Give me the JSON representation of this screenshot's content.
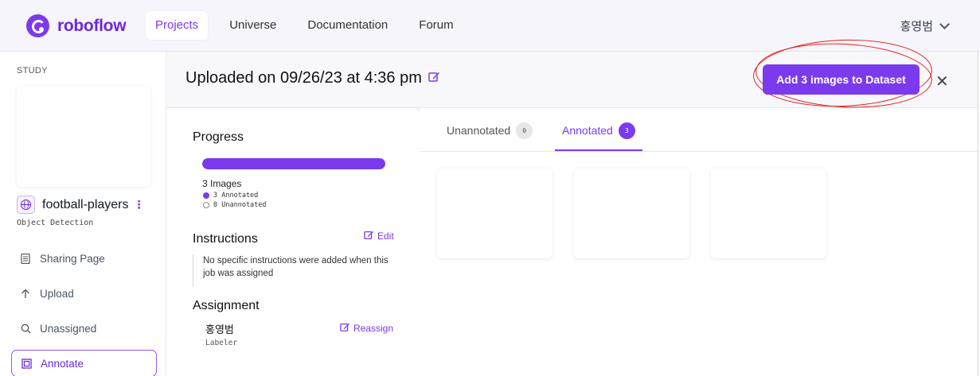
{
  "brand": {
    "name": "roboflow",
    "accent": "#7c3aed"
  },
  "nav": {
    "items": [
      "Projects",
      "Universe",
      "Documentation",
      "Forum"
    ],
    "active": "Projects"
  },
  "user": {
    "name": "홍영범"
  },
  "sidebar": {
    "section_label": "STUDY",
    "project_name": "football-players",
    "project_type": "Object Detection",
    "items": [
      {
        "label": "Sharing Page",
        "icon": "document-icon"
      },
      {
        "label": "Upload",
        "icon": "arrow-up-icon"
      },
      {
        "label": "Unassigned",
        "icon": "search-icon"
      },
      {
        "label": "Annotate",
        "icon": "annotate-icon",
        "active": true
      }
    ]
  },
  "header": {
    "title": "Uploaded on 09/26/23 at 4:36 pm",
    "add_button": "Add 3 images to Dataset"
  },
  "panel": {
    "progress_title": "Progress",
    "progress_fraction": 1.0,
    "image_count": "3 Images",
    "annotated_text": "3 Annotated",
    "unannotated_text": "0 Unannotated",
    "instructions_title": "Instructions",
    "edit_label": "Edit",
    "instructions_text": "No specific instructions were added when this job was assigned",
    "assignment_title": "Assignment",
    "reassign_label": "Reassign",
    "assignee": "홍영범",
    "assignee_role": "Labeler"
  },
  "tabs": [
    {
      "label": "Unannotated",
      "count": "0",
      "active": false
    },
    {
      "label": "Annotated",
      "count": "3",
      "active": true
    }
  ],
  "image_cards": 3
}
